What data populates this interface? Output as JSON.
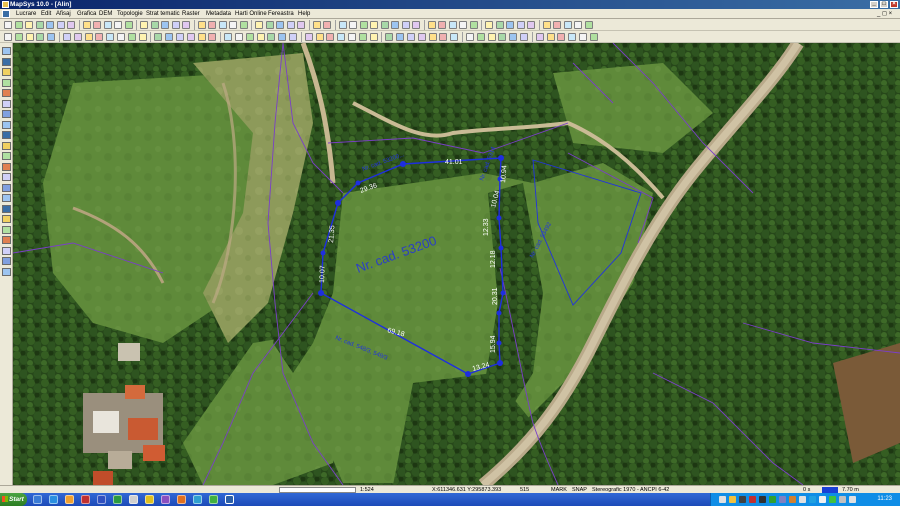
{
  "window": {
    "title": "MapSys 10.0 - [Alin]",
    "minimize": "_",
    "maximize": "□",
    "close": "×"
  },
  "menu": {
    "items": [
      {
        "label": "Lucrare"
      },
      {
        "label": "Edit"
      },
      {
        "label": "Afisaj"
      },
      {
        "label": "Grafica"
      },
      {
        "label": "DEM"
      },
      {
        "label": "Topologie"
      },
      {
        "label": "Strat tematic"
      },
      {
        "label": "Raster"
      },
      {
        "label": "Metadata"
      },
      {
        "label": "Harti Online"
      },
      {
        "label": "Fereastra"
      },
      {
        "label": "Help"
      }
    ],
    "doc_controls": "_ ◻ ×"
  },
  "map": {
    "parcel_label": "Nr. cad. 53200",
    "neighbor_labels": [
      "Nr. cad. 53200...",
      "Nr. cad. 5314",
      "Nr. cad. 53492",
      "Nr. cad. 548/3, 549/3"
    ],
    "segment_lengths": [
      "41.01",
      "29.36",
      "21.35",
      "10.07",
      "69.18",
      "13.24",
      "15.94",
      "20.31",
      "12.18",
      "12.33",
      "10.04",
      "10.94"
    ],
    "colors": {
      "parcel_line": "#1e2ee0",
      "neighbor_line": "#7a3fc8",
      "vertex": "#1e2ee0",
      "label": "#2233dd"
    }
  },
  "statusbar": {
    "scale": "1:524",
    "coords": "X:611346.631 Y:295873.393",
    "field_a": "515",
    "mark": "MARK",
    "snap": "SNAP",
    "projection": "Stereografic 1970 - ANCPI 6-42",
    "zero": "0 s",
    "right_value": "7.70 m"
  },
  "taskbar": {
    "start_label": "Start",
    "clock": "11:23"
  }
}
